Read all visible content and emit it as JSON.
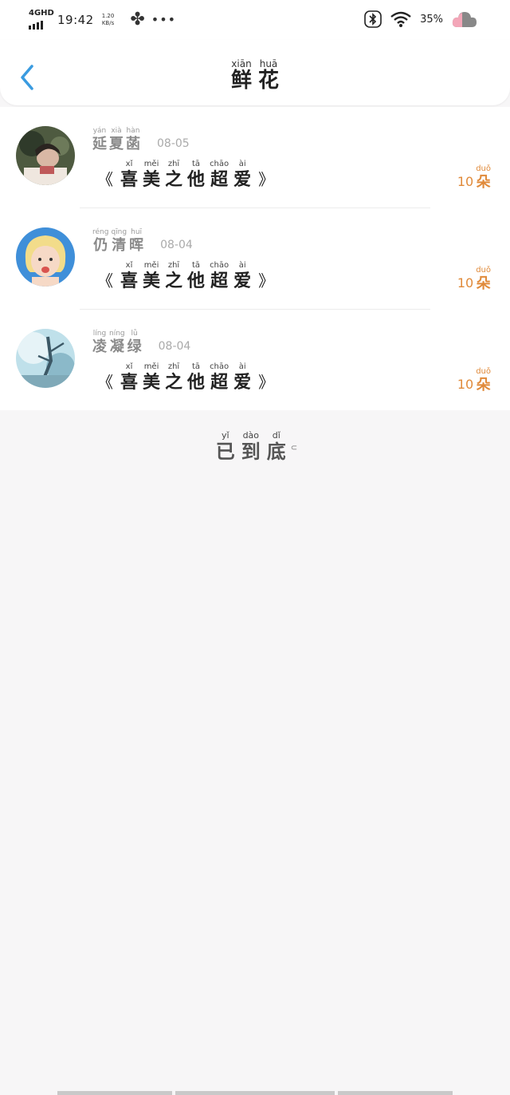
{
  "status_bar": {
    "network": "4GHD",
    "time": "19:42",
    "speed_value": "1.20",
    "speed_unit": "KB/s",
    "battery": "35%"
  },
  "header": {
    "title": [
      {
        "py": "xiān",
        "hz": "鲜"
      },
      {
        "py": "huā",
        "hz": "花"
      }
    ]
  },
  "records": [
    {
      "name": [
        {
          "py": "yán",
          "hz": "延"
        },
        {
          "py": "xià",
          "hz": "夏"
        },
        {
          "py": "hàn",
          "hz": "菡"
        }
      ],
      "date": "08-05",
      "gift": [
        {
          "py": "xǐ",
          "hz": "喜"
        },
        {
          "py": "měi",
          "hz": "美"
        },
        {
          "py": "zhī",
          "hz": "之"
        },
        {
          "py": "tā",
          "hz": "他"
        },
        {
          "py": "chāo",
          "hz": "超"
        },
        {
          "py": "ài",
          "hz": "爱"
        }
      ],
      "count": "10",
      "unit": {
        "py": "duǒ",
        "hz": "朵"
      },
      "avatar_color": "#5b6b4a"
    },
    {
      "name": [
        {
          "py": "réng",
          "hz": "仍"
        },
        {
          "py": "qīng",
          "hz": "清"
        },
        {
          "py": "huī",
          "hz": "晖"
        }
      ],
      "date": "08-04",
      "gift": [
        {
          "py": "xǐ",
          "hz": "喜"
        },
        {
          "py": "měi",
          "hz": "美"
        },
        {
          "py": "zhī",
          "hz": "之"
        },
        {
          "py": "tā",
          "hz": "他"
        },
        {
          "py": "chāo",
          "hz": "超"
        },
        {
          "py": "ài",
          "hz": "爱"
        }
      ],
      "count": "10",
      "unit": {
        "py": "duǒ",
        "hz": "朵"
      },
      "avatar_color": "#3f8fd9"
    },
    {
      "name": [
        {
          "py": "líng",
          "hz": "凌"
        },
        {
          "py": "níng",
          "hz": "凝"
        },
        {
          "py": "lǜ",
          "hz": "绿"
        }
      ],
      "date": "08-04",
      "gift": [
        {
          "py": "xǐ",
          "hz": "喜"
        },
        {
          "py": "měi",
          "hz": "美"
        },
        {
          "py": "zhī",
          "hz": "之"
        },
        {
          "py": "tā",
          "hz": "他"
        },
        {
          "py": "chāo",
          "hz": "超"
        },
        {
          "py": "ài",
          "hz": "爱"
        }
      ],
      "count": "10",
      "unit": {
        "py": "duǒ",
        "hz": "朵"
      },
      "avatar_color": "#9cc7d6"
    }
  ],
  "footer": {
    "end_text": [
      {
        "py": "yǐ",
        "hz": "已"
      },
      {
        "py": "dào",
        "hz": "到"
      },
      {
        "py": "dǐ",
        "hz": "底"
      }
    ]
  },
  "colors": {
    "accent": "#3a9be0",
    "count": "#e08a3a",
    "background": "#f7f6f7"
  }
}
